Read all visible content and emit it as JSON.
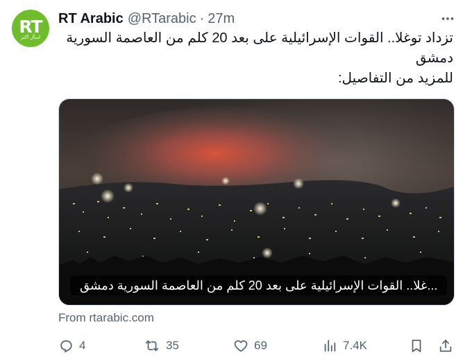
{
  "avatar": {
    "logo_text": "RT",
    "logo_subtext": "اسأل أكثر",
    "bg_color": "#6fbd2f"
  },
  "header": {
    "name": "RT Arabic",
    "handle": "@RTarabic",
    "separator": "·",
    "time": "27m",
    "more_icon": "more-horizontal-icon"
  },
  "tweet": {
    "lines": [
      "تزداد توغلا.. القوات الإسرائيلية على بعد 20 كلم من العاصمة السورية",
      "دمشق",
      "للمزيد من التفاصيل:"
    ]
  },
  "media": {
    "headline": "...غلا.. القوات الإسرائيلية على بعد 20 كلم من العاصمة السورية دمشق",
    "description_icon": "night-city-fire-photo"
  },
  "card": {
    "source": "From rtarabic.com"
  },
  "actions": {
    "reply": {
      "icon": "reply-icon",
      "count": "4"
    },
    "repost": {
      "icon": "repost-icon",
      "count": "35"
    },
    "like": {
      "icon": "heart-icon",
      "count": "69"
    },
    "views": {
      "icon": "views-icon",
      "count": "7.4K"
    },
    "bookmark": {
      "icon": "bookmark-icon"
    },
    "share": {
      "icon": "share-icon"
    },
    "icon_color": "#536471"
  }
}
